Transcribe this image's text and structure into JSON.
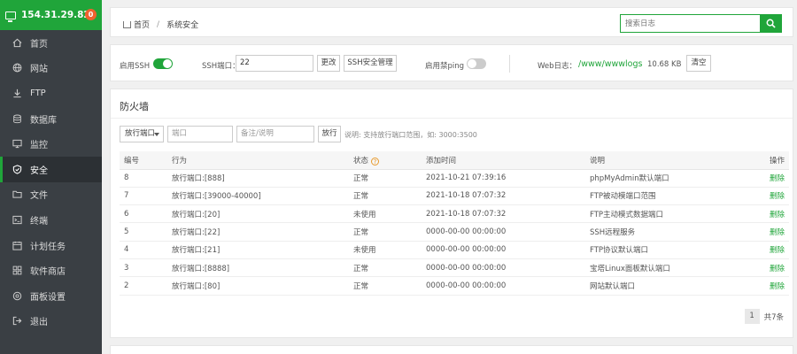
{
  "sidebar": {
    "ip": "154.31.29.82",
    "badge": "0",
    "items": [
      {
        "label": "首页",
        "icon": "home-icon"
      },
      {
        "label": "网站",
        "icon": "globe-icon"
      },
      {
        "label": "FTP",
        "icon": "ftp-icon"
      },
      {
        "label": "数据库",
        "icon": "database-icon"
      },
      {
        "label": "监控",
        "icon": "monitor-icon"
      },
      {
        "label": "安全",
        "icon": "shield-icon"
      },
      {
        "label": "文件",
        "icon": "folder-icon"
      },
      {
        "label": "终端",
        "icon": "terminal-icon"
      },
      {
        "label": "计划任务",
        "icon": "calendar-icon"
      },
      {
        "label": "软件商店",
        "icon": "store-icon"
      },
      {
        "label": "面板设置",
        "icon": "settings-icon"
      },
      {
        "label": "退出",
        "icon": "logout-icon"
      }
    ]
  },
  "breadcrumb": {
    "home": "首页",
    "current": "系统安全"
  },
  "search": {
    "placeholder": "搜索日志"
  },
  "settings": {
    "ssh_label": "启用SSH",
    "ssh_enabled": true,
    "port_label": "SSH端口：",
    "port_value": "22",
    "change_btn": "更改",
    "manage_btn": "SSH安全管理",
    "ping_label": "启用禁ping",
    "ping_enabled": false,
    "weblog_label": "Web日志：",
    "weblog_path": "/www/wwwlogs",
    "weblog_size": "10.68 KB",
    "clear_btn": "清空"
  },
  "firewall": {
    "title": "防火墙",
    "select_value": "放行端口",
    "port_placeholder": "端口",
    "note_placeholder": "备注/说明",
    "allow_btn": "放行",
    "hint": "说明: 支持放行端口范围，如: 3000:3500",
    "columns": [
      "编号",
      "行为",
      "状态",
      "添加时间",
      "说明",
      "操作"
    ],
    "rows": [
      [
        "8",
        "放行端口:[888]",
        "正常",
        "2021-10-21 07:39:16",
        "phpMyAdmin默认端口",
        "删除"
      ],
      [
        "7",
        "放行端口:[39000-40000]",
        "正常",
        "2021-10-18 07:07:32",
        "FTP被动模端口范围",
        "删除"
      ],
      [
        "6",
        "放行端口:[20]",
        "未使用",
        "2021-10-18 07:07:32",
        "FTP主动模式数据端口",
        "删除"
      ],
      [
        "5",
        "放行端口:[22]",
        "正常",
        "0000-00-00 00:00:00",
        "SSH远程服务",
        "删除"
      ],
      [
        "4",
        "放行端口:[21]",
        "未使用",
        "0000-00-00 00:00:00",
        "FTP协议默认端口",
        "删除"
      ],
      [
        "3",
        "放行端口:[8888]",
        "正常",
        "0000-00-00 00:00:00",
        "宝塔Linux面板默认端口",
        "删除"
      ],
      [
        "2",
        "放行端口:[80]",
        "正常",
        "0000-00-00 00:00:00",
        "网站默认端口",
        "删除"
      ]
    ],
    "page": "1",
    "total": "共7条"
  },
  "colors": {
    "accent": "#20a53a",
    "sidebar": "#3a3f44",
    "badge": "#f0612e"
  }
}
